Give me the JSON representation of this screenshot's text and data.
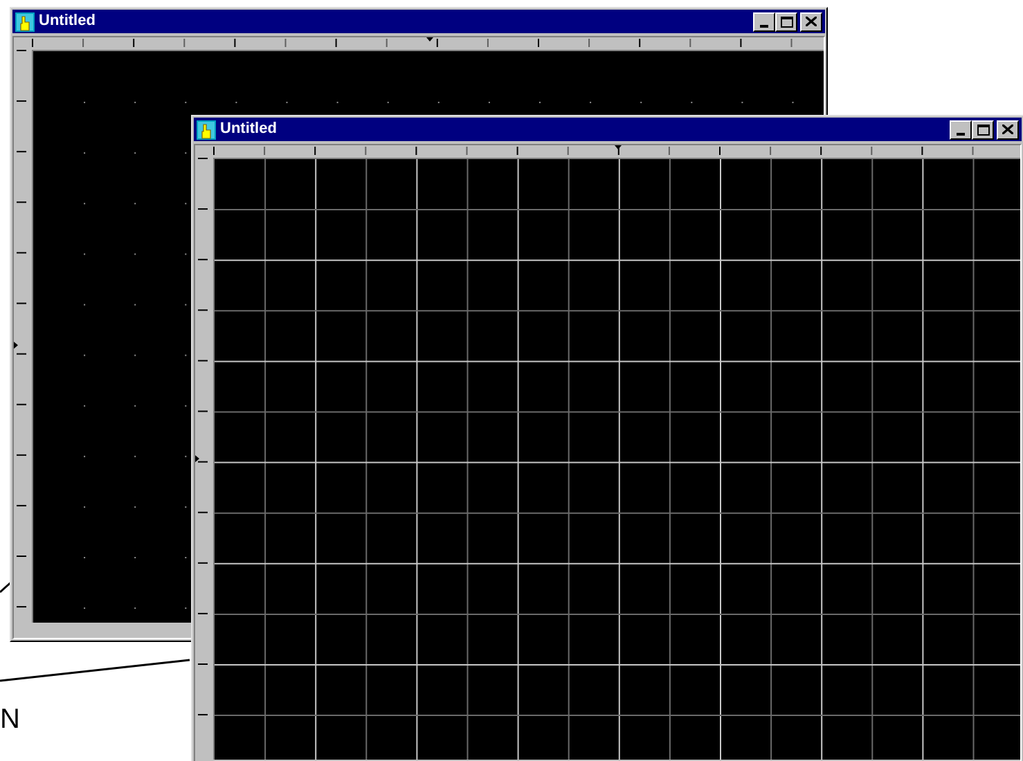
{
  "windows": [
    {
      "title": "Untitled",
      "kind": "dots"
    },
    {
      "title": "Untitled",
      "kind": "lines"
    }
  ],
  "callout": {
    "text": "N"
  }
}
